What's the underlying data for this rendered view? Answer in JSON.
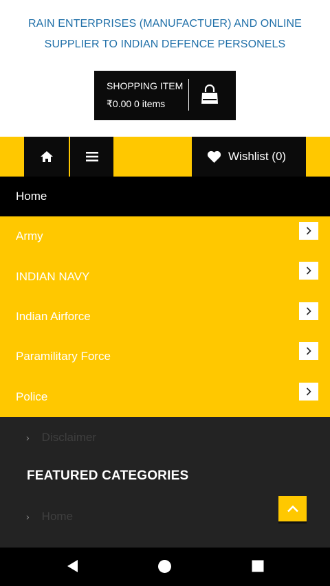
{
  "header": {
    "title_line1": "RAIN ENTERPRISES (MANUFACTUER) AND ONLINE",
    "title_line2": "SUPPLIER TO INDIAN DEFENCE PERSONELS"
  },
  "cart": {
    "label": "SHOPPING ITEM",
    "amount": "₹0.00 0 items",
    "icon": "shopping-bag-icon"
  },
  "navbar": {
    "home_icon": "home-icon",
    "menu_icon": "hamburger-menu-icon",
    "wishlist_label": "Wishlist",
    "wishlist_count": "(0)"
  },
  "menu": {
    "home": "Home",
    "items": [
      {
        "label": "Army"
      },
      {
        "label": "INDIAN NAVY"
      },
      {
        "label": "Indian Airforce"
      },
      {
        "label": "Paramilitary Force"
      },
      {
        "label": "Police"
      }
    ]
  },
  "footer": {
    "disclaimer_link": "Disclaimer",
    "featured_heading": "FEATURED CATEGORIES",
    "home_link": "Home"
  },
  "colors": {
    "accent": "#ffc800",
    "dark": "#0b0b0b",
    "title_blue": "#1f6fa8",
    "footer_bg": "#232323"
  }
}
